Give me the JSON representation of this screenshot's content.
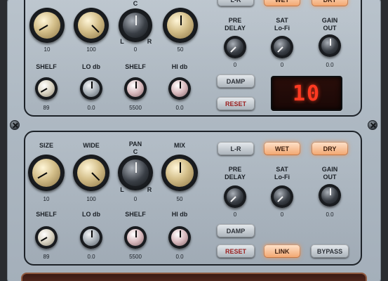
{
  "theme": {
    "chassis": "#aeb9c3",
    "accent_orange": "#f2a56e",
    "lcd_red": "#ff3a22",
    "reset_red": "#9a1e1e"
  },
  "top": {
    "knobs": [
      {
        "value": "10",
        "angle": -120
      },
      {
        "value": "100",
        "angle": 135
      },
      {
        "label": "C",
        "left": "L",
        "right": "R",
        "value": "0",
        "angle": 0
      },
      {
        "value": "50",
        "angle": 0
      }
    ],
    "pre_delay": {
      "label": "PRE\nDELAY",
      "value": "0"
    },
    "sat": {
      "label": "SAT\nLo-Fi",
      "value": "0"
    },
    "gain_out": {
      "label": "GAIN\nOUT",
      "value": "0.0"
    },
    "eq": [
      {
        "label": "SHELF",
        "value": "89"
      },
      {
        "label": "LO db",
        "value": "0.0"
      },
      {
        "label": "SHELF",
        "value": "5500"
      },
      {
        "label": "HI db",
        "value": "0.0"
      }
    ],
    "buttons": {
      "lr": "L-R",
      "wet": "WET",
      "dry": "DRY",
      "damp": "DAMP",
      "reset": "RESET"
    },
    "lcd": "10"
  },
  "bottom": {
    "knobs": [
      {
        "label": "SIZE",
        "value": "10",
        "angle": -120
      },
      {
        "label": "WIDE",
        "value": "100",
        "angle": 135
      },
      {
        "label": "PAN\nC",
        "left": "L",
        "right": "R",
        "value": "0",
        "angle": 0
      },
      {
        "label": "MIX",
        "value": "50",
        "angle": 0
      }
    ],
    "pre_delay": {
      "label": "PRE\nDELAY",
      "value": "0"
    },
    "sat": {
      "label": "SAT\nLo-Fi",
      "value": "0"
    },
    "gain_out": {
      "label": "GAIN\nOUT",
      "value": "0.0"
    },
    "eq": [
      {
        "label": "SHELF",
        "value": "89"
      },
      {
        "label": "LO db",
        "value": "0.0"
      },
      {
        "label": "SHELF",
        "value": "5500"
      },
      {
        "label": "HI db",
        "value": "0.0"
      }
    ],
    "buttons": {
      "lr": "L-R",
      "wet": "WET",
      "dry": "DRY",
      "damp": "DAMP",
      "reset": "RESET",
      "link": "LINK",
      "bypass": "BYPASS"
    }
  }
}
